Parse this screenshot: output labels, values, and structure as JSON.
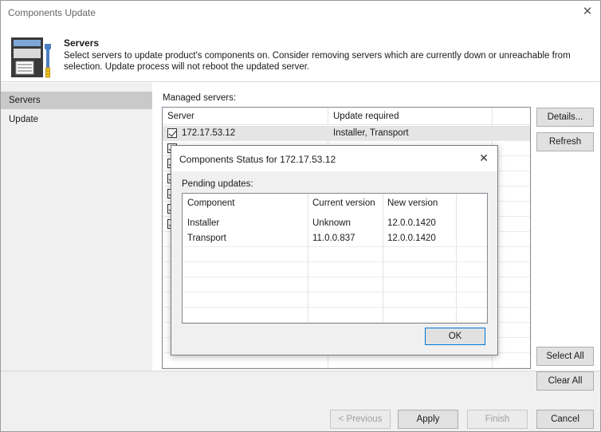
{
  "window": {
    "title": "Components Update",
    "close_glyph": "✕"
  },
  "header": {
    "title": "Servers",
    "description": "Select servers to update product's components on. Consider removing servers which are currently down or unreachable from selection. Update process will not reboot the updated server.",
    "icon": "server-wrench-icon"
  },
  "sidebar": {
    "items": [
      {
        "label": "Servers",
        "active": true
      },
      {
        "label": "Update",
        "active": false
      }
    ]
  },
  "managed": {
    "label": "Managed servers:",
    "columns": [
      "Server",
      "Update required"
    ],
    "rows": [
      {
        "server": "172.17.53.12",
        "update": "Installer, Transport",
        "checked": true,
        "selected": true
      },
      {
        "server": "",
        "update": "",
        "checked": true,
        "selected": false
      },
      {
        "server": "",
        "update": "",
        "checked": true,
        "selected": false
      },
      {
        "server": "",
        "update": "",
        "checked": true,
        "selected": false
      },
      {
        "server": "",
        "update": "",
        "checked": true,
        "selected": false
      },
      {
        "server": "",
        "update": "",
        "checked": true,
        "selected": false
      },
      {
        "server": "",
        "update": "",
        "checked": true,
        "selected": false
      }
    ]
  },
  "side_buttons": {
    "details": "Details...",
    "refresh": "Refresh",
    "select_all": "Select All",
    "clear_all": "Clear All"
  },
  "dialog": {
    "title": "Components Status for 172.17.53.12",
    "close_glyph": "✕",
    "pending_label": "Pending updates:",
    "columns": [
      "Component",
      "Current version",
      "New version"
    ],
    "rows": [
      {
        "component": "Installer",
        "current": "Unknown",
        "new": "12.0.0.1420"
      },
      {
        "component": "Transport",
        "current": "11.0.0.837",
        "new": "12.0.0.1420"
      }
    ],
    "ok": "OK"
  },
  "footer": {
    "previous": "< Previous",
    "apply": "Apply",
    "finish": "Finish",
    "cancel": "Cancel"
  }
}
